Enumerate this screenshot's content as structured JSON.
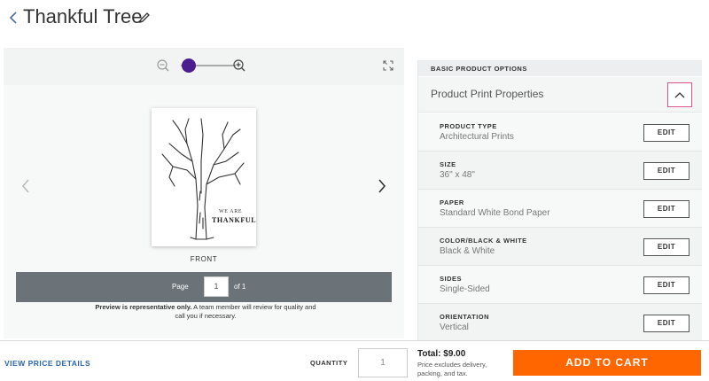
{
  "header": {
    "title": "Thankful Tree"
  },
  "preview": {
    "zoom_level": 0.1,
    "thumbnail_text_line1": "WE ARE",
    "thumbnail_text_line2": "THANKFUL",
    "side_label": "FRONT",
    "pager": {
      "page_label": "Page",
      "current_page": "1",
      "of_label": "of 1"
    },
    "disclaimer_bold": "Preview is representative only.",
    "disclaimer_rest": " A team member will review for quality and call you if necessary."
  },
  "options": {
    "section_title": "BASIC PRODUCT OPTIONS",
    "group_label": "Product Print Properties",
    "edit_label": "EDIT",
    "rows": [
      {
        "name": "PRODUCT TYPE",
        "value": "Architectural Prints"
      },
      {
        "name": "SIZE",
        "value": "36\" x 48\""
      },
      {
        "name": "PAPER",
        "value": "Standard White Bond Paper"
      },
      {
        "name": "COLOR/BLACK & WHITE",
        "value": "Black & White"
      },
      {
        "name": "SIDES",
        "value": "Single-Sided"
      },
      {
        "name": "ORIENTATION",
        "value": "Vertical"
      }
    ]
  },
  "footer": {
    "price_details": "VIEW PRICE DETAILS",
    "quantity_label": "QUANTITY",
    "quantity_value": "1",
    "total": "Total:  $9.00",
    "total_note": "Price excludes delivery, packing, and tax.",
    "cart_button": "ADD TO CART"
  },
  "colors": {
    "accent": "#ff6600",
    "link": "#2a66b1",
    "zoom_knob": "#4b1d8e",
    "collapse_border": "#e0538a"
  }
}
